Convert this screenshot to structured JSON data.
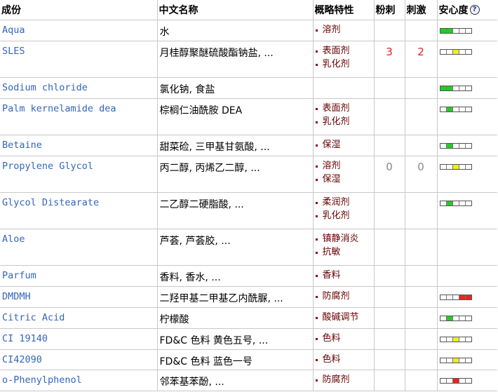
{
  "headers": {
    "ingredient": "成份",
    "chinese_name": "中文名称",
    "function": "概略特性",
    "acne": "粉刺",
    "irritation": "刺激",
    "safety": "安心度",
    "help_glyph": "?"
  },
  "colors": {
    "green": "#22cc22",
    "yellow": "#eeee22",
    "red": "#ee2222",
    "link": "#3366bb",
    "function_text": "#660000"
  },
  "rows": [
    {
      "name": "Aqua",
      "cn": "水",
      "functions": [
        "溶剂"
      ],
      "acne": "",
      "irritation": "",
      "safety_cells": [
        "green",
        "green",
        "empty",
        "empty",
        "empty"
      ]
    },
    {
      "name": "SLES",
      "cn": "月桂醇聚醚硫酸酯钠盐, ...",
      "functions": [
        "表面剂",
        "乳化剂"
      ],
      "acne": "3",
      "irritation": "2",
      "num_color": "red",
      "safety_cells": [
        "empty",
        "empty",
        "yellow",
        "empty",
        "empty"
      ]
    },
    {
      "name": "Sodium chloride",
      "cn": "氯化钠, 食盐",
      "functions": [],
      "acne": "",
      "irritation": "",
      "safety_cells": [
        "green",
        "green",
        "empty",
        "empty",
        "empty"
      ]
    },
    {
      "name": "Palm kernelamide dea",
      "cn": "棕榈仁油酰胺 DEA",
      "functions": [
        "表面剂",
        "乳化剂"
      ],
      "acne": "",
      "irritation": "",
      "safety_cells": [
        "empty",
        "green",
        "empty",
        "empty",
        "empty"
      ]
    },
    {
      "name": "Betaine",
      "cn": "甜菜硷, 三甲基甘氨酸, ...",
      "functions": [
        "保湿"
      ],
      "acne": "",
      "irritation": "",
      "safety_cells": [
        "empty",
        "green",
        "empty",
        "empty",
        "empty"
      ]
    },
    {
      "name": "Propylene Glycol",
      "cn": "丙二醇, 丙烯乙二醇, ...",
      "functions": [
        "溶剂",
        "保湿"
      ],
      "acne": "0",
      "irritation": "0",
      "num_color": "grey",
      "safety_cells": [
        "empty",
        "empty",
        "yellow",
        "empty",
        "empty"
      ]
    },
    {
      "name": "Glycol Distearate",
      "cn": "二乙醇二硬脂酸, ...",
      "functions": [
        "柔润剂",
        "乳化剂"
      ],
      "acne": "",
      "irritation": "",
      "safety_cells": [
        "empty",
        "green",
        "empty",
        "empty",
        "empty"
      ]
    },
    {
      "name": "Aloe",
      "cn": "芦荟, 芦荟胶, ...",
      "functions": [
        "镇静消炎",
        "抗敏"
      ],
      "acne": "",
      "irritation": "",
      "safety_cells": []
    },
    {
      "name": "Parfum",
      "cn": "香料, 香水, ...",
      "functions": [
        "香料"
      ],
      "acne": "",
      "irritation": "",
      "safety_cells": []
    },
    {
      "name": "DMDMH",
      "cn": "二羟甲基二甲基乙内酰脲, ...",
      "functions": [
        "防腐剂"
      ],
      "acne": "",
      "irritation": "",
      "safety_cells": [
        "empty",
        "empty",
        "empty",
        "red",
        "red"
      ]
    },
    {
      "name": "Citric Acid",
      "cn": "柠檬酸",
      "functions": [
        "酸碱调节"
      ],
      "acne": "",
      "irritation": "",
      "safety_cells": [
        "empty",
        "green",
        "empty",
        "empty",
        "empty"
      ]
    },
    {
      "name": "CI 19140",
      "cn": "FD&C 色料 黄色五号, ...",
      "functions": [
        "色料"
      ],
      "acne": "",
      "irritation": "",
      "safety_cells": [
        "empty",
        "empty",
        "yellow",
        "empty",
        "empty"
      ]
    },
    {
      "name": "CI42090",
      "cn": "FD&C 色料 蓝色一号",
      "functions": [
        "色料"
      ],
      "acne": "",
      "irritation": "",
      "safety_cells": [
        "empty",
        "empty",
        "yellow",
        "empty",
        "empty"
      ]
    },
    {
      "name": "o-Phenylphenol",
      "cn": "邻苯基苯酚, ...",
      "functions": [
        "防腐剂"
      ],
      "acne": "",
      "irritation": "",
      "safety_cells": [
        "empty",
        "empty",
        "red",
        "empty",
        "empty"
      ]
    }
  ]
}
